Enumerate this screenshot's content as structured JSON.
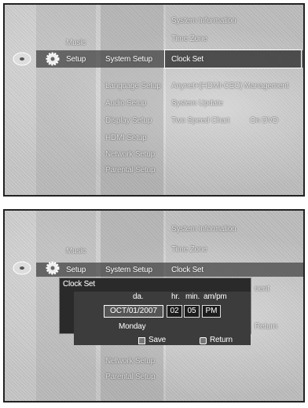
{
  "top_screen": {
    "left_menu": [
      "Music",
      "Setup"
    ],
    "middle_menu": [
      "System Setup",
      "Language Setup",
      "Audio Setup",
      "Display Setup",
      "HDMI Setup",
      "Network Setup",
      "Parental Setup"
    ],
    "right_menu": [
      "System Information",
      "Time Zone",
      "Clock Set",
      "Anynet+(HDMI-CEC) Management",
      "System Update",
      "Two Speed Chart"
    ],
    "right_value": "On DVD"
  },
  "bottom_screen": {
    "left_menu": [
      "Music",
      "Setup"
    ],
    "middle_menu_top": "System Setup",
    "middle_menu_bottom": [
      "Network Setup",
      "Parental Setup"
    ],
    "right_menu": [
      "System Information",
      "Time Zone",
      "Clock Set"
    ],
    "right_partial": [
      "nent",
      "Return"
    ],
    "dialog": {
      "title": "Clock Set",
      "headers": {
        "date": "da.",
        "hour": "hr.",
        "min": "min.",
        "ampm": "am/pm"
      },
      "date_value": "OCT/01/2007",
      "hour_value": "02",
      "min_value": "05",
      "ampm_value": "PM",
      "weekday": "Monday",
      "save_label": "Save",
      "return_label": "Return"
    }
  }
}
